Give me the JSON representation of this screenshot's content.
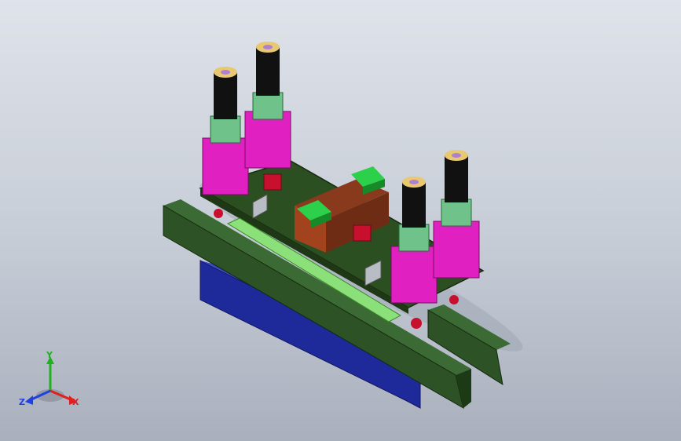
{
  "triad": {
    "x_label": "X",
    "y_label": "Y",
    "z_label": "Z",
    "colors": {
      "x": "#e02020",
      "y": "#20b020",
      "z": "#2040e0"
    }
  },
  "model": {
    "icon": "cad-assembly-icon",
    "cylinder_count": 4
  }
}
